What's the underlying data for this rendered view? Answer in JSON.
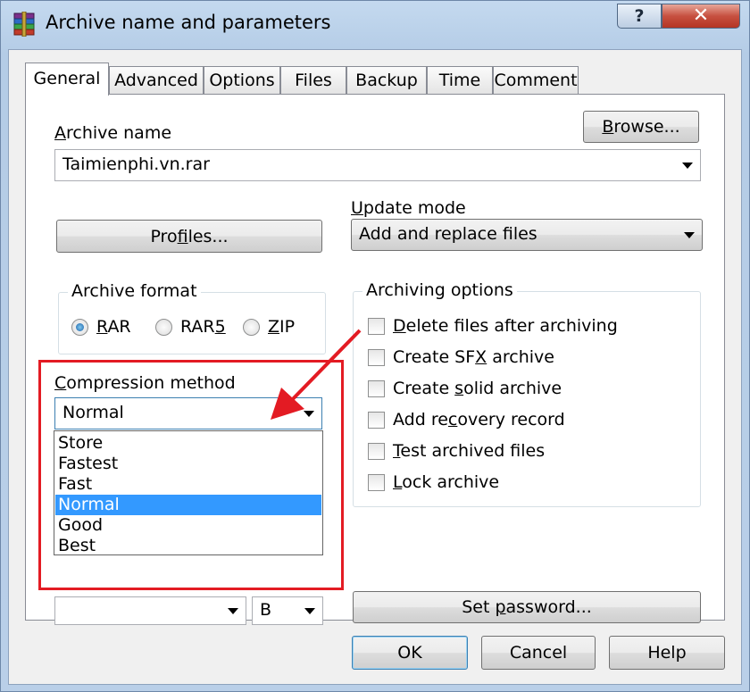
{
  "window": {
    "title": "Archive name and parameters",
    "help_label": "?",
    "close_label": "✕"
  },
  "tabs": [
    {
      "label": "General",
      "active": true
    },
    {
      "label": "Advanced"
    },
    {
      "label": "Options"
    },
    {
      "label": "Files"
    },
    {
      "label": "Backup"
    },
    {
      "label": "Time"
    },
    {
      "label": "Comment"
    }
  ],
  "general": {
    "archive_name_label_u": "A",
    "archive_name_label_rest": "rchive name",
    "browse_u": "B",
    "browse_rest": "rowse...",
    "archive_name_value": "Taimienphi.vn.rar",
    "profiles_pre": "Pro",
    "profiles_u": "f",
    "profiles_rest": "iles...",
    "update_mode_u": "U",
    "update_mode_rest": "pdate mode",
    "update_mode_value": "Add and replace files",
    "archive_format_label": "Archive format",
    "formats": [
      {
        "pre": "",
        "u": "R",
        "post": "AR",
        "checked": true
      },
      {
        "pre": "RAR",
        "u": "5",
        "post": "",
        "checked": false
      },
      {
        "pre": "",
        "u": "Z",
        "post": "IP",
        "checked": false
      }
    ],
    "compression_label_u": "C",
    "compression_label_rest": "ompression method",
    "compression_value": "Normal",
    "compression_options": [
      "Store",
      "Fastest",
      "Fast",
      "Normal",
      "Good",
      "Best"
    ],
    "compression_selected_index": 3,
    "volume_unit_value": "B",
    "archiving_options_label": "Archiving options",
    "archiving_options": [
      {
        "pre": "",
        "u": "D",
        "post": "elete files after archiving",
        "checked": false
      },
      {
        "pre": "Create SF",
        "u": "X",
        "post": " archive",
        "checked": false
      },
      {
        "pre": "Create ",
        "u": "s",
        "post": "olid archive",
        "checked": false
      },
      {
        "pre": "Add re",
        "u": "c",
        "post": "overy record",
        "checked": false
      },
      {
        "pre": "",
        "u": "T",
        "post": "est archived files",
        "checked": false
      },
      {
        "pre": "",
        "u": "L",
        "post": "ock archive",
        "checked": false
      }
    ],
    "set_password_pre": "Set ",
    "set_password_u": "p",
    "set_password_rest": "assword..."
  },
  "footer": {
    "ok_label": "OK",
    "cancel_label": "Cancel",
    "help_label": "Help"
  },
  "colors": {
    "highlight": "#3399ff",
    "annotation": "#e31b23",
    "window_frame": "#b9cfe8"
  }
}
